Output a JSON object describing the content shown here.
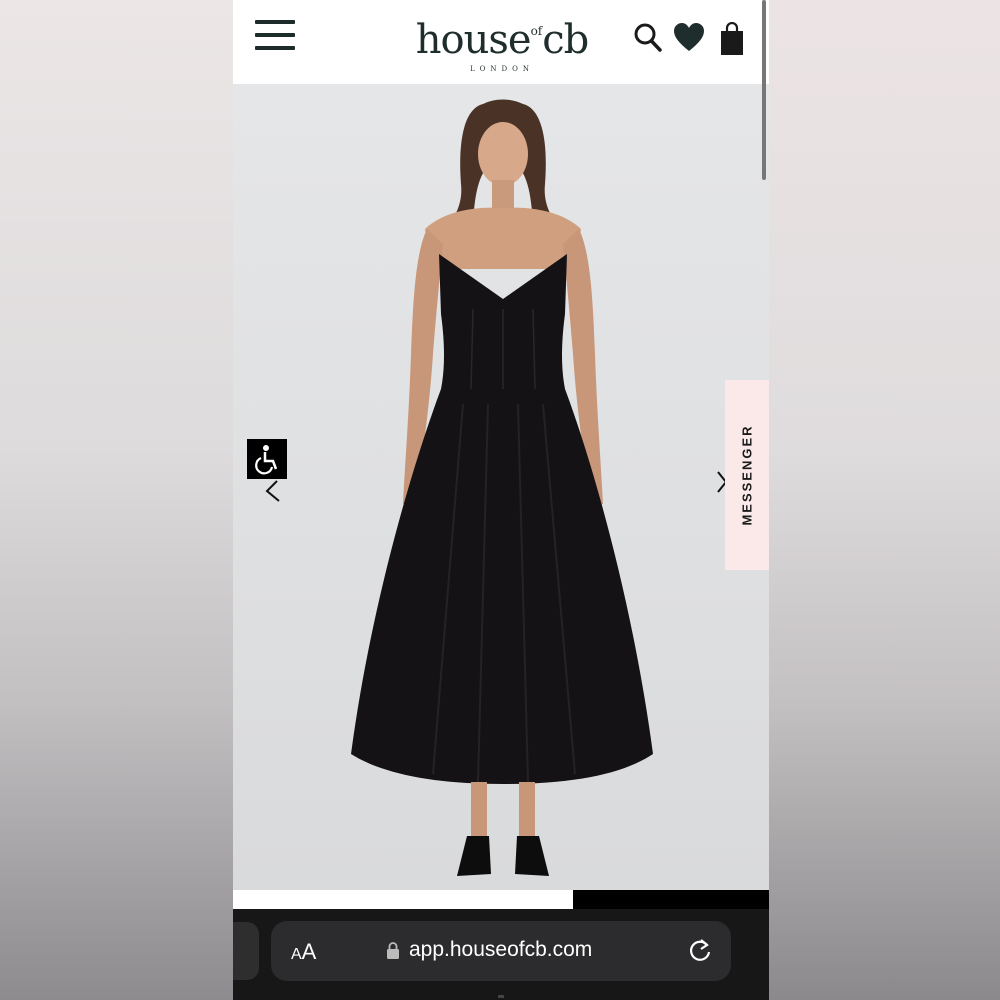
{
  "header": {
    "logo_main": "house",
    "logo_of": "of",
    "logo_cb": "cb",
    "logo_sub": "LONDON"
  },
  "icons": {
    "menu": "hamburger-icon",
    "search": "search-icon",
    "wishlist": "heart-icon",
    "bag": "shopping-bag-icon",
    "accessibility": "wheelchair-icon",
    "prev": "chevron-left-icon",
    "next": "chevron-right-icon",
    "lock": "lock-icon",
    "reload": "reload-icon"
  },
  "hero": {
    "messenger_label": "MESSENGER"
  },
  "gallery": {
    "progress_fraction": 0.635
  },
  "browser": {
    "text_size_label_small": "A",
    "text_size_label_big": "A",
    "url": "app.houseofcb.com"
  },
  "colors": {
    "brand": "#1f2e2c",
    "messenger_bg": "#fbe9ea",
    "dress": "#141214"
  }
}
